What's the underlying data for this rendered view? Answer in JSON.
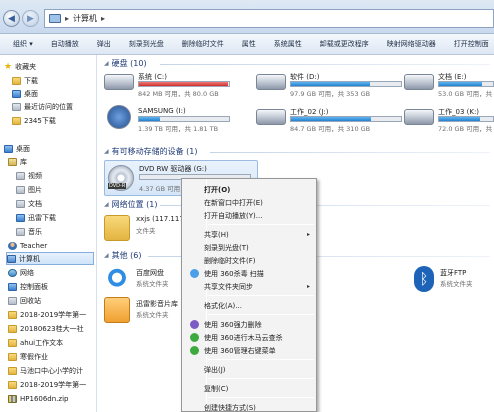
{
  "address": {
    "path_root": "▸",
    "path": "计算机",
    "path_arrow": "▸"
  },
  "toolbar": [
    "组织 ▾",
    "自动播放",
    "弹出",
    "刻录到光盘",
    "删除临时文件",
    "属性",
    "系统属性",
    "卸载或更改程序",
    "映射网络驱动器",
    "打开控制面"
  ],
  "nav": {
    "favorites": {
      "label": "收藏夹",
      "items": [
        "下载",
        "桌面",
        "最近访问的位置",
        "2345下载"
      ]
    },
    "desktop": "桌面",
    "libraries": {
      "label": "库",
      "items": [
        "视频",
        "图片",
        "文档",
        "迅雷下载",
        "音乐"
      ]
    },
    "teacher": "Teacher",
    "computer": "计算机",
    "network": "网络",
    "control_panel": "控制面板",
    "recycle": "回收站",
    "folders": [
      "2018-2019学年第一",
      "20180623桂大一社",
      "ahui工作文本",
      "寒假作业",
      "马池口中心小学的计",
      "2018-2019学年第一",
      "HP1606dn.zip"
    ]
  },
  "groups": {
    "hdd": "硬盘 (10)",
    "removable": "有可移动存储的设备 (1)",
    "netloc": "网络位置 (1)",
    "other": "其他 (6)"
  },
  "drives": [
    {
      "name": "系统 (C:)",
      "sub": "842 MB 可用，共 80.0 GB",
      "used": 0.99,
      "warn": true
    },
    {
      "name": "软件 (D:)",
      "sub": "97.9 GB 可用，共 353 GB",
      "used": 0.72,
      "warn": false
    },
    {
      "name": "文档 (E:)",
      "sub": "53.0 GB 可用，共",
      "used": 0.8,
      "warn": false
    },
    {
      "name": "SAMSUNG (I:)",
      "sub": "1.39 TB 可用，共 1.81 TB",
      "used": 0.23,
      "warn": false
    },
    {
      "name": "工作_02 (J:)",
      "sub": "84.7 GB 可用，共 310 GB",
      "used": 0.73,
      "warn": false
    },
    {
      "name": "工作_03 (K:)",
      "sub": "72.0 GB 可用，共",
      "used": 0.75,
      "warn": false
    }
  ],
  "dvd": {
    "name": "DVD RW 驱动器 (G:)",
    "sub": "4.37 GB 可用，共",
    "tag": "DVD-R",
    "used": 0.05
  },
  "netloc": {
    "name": "xxjs (117.117",
    "sub": "文件夹"
  },
  "other": [
    {
      "name": "百度网盘",
      "sub": "系统文件夹"
    },
    {
      "name": "迅雷影音片库",
      "sub": "系统文件夹"
    },
    {
      "name": "蓝牙FTP",
      "sub": "系统文件夹"
    }
  ],
  "menu": [
    {
      "label": "打开(O)",
      "bold": true
    },
    {
      "label": "在新窗口中打开(E)"
    },
    {
      "label": "打开自动播放(Y)..."
    },
    {
      "sep": true
    },
    {
      "label": "共享(H)",
      "arrow": "▸"
    },
    {
      "label": "刻录到光盘(T)"
    },
    {
      "label": "删除临时文件(F)"
    },
    {
      "label": "使用 360杀毒 扫描",
      "icon": "#4aa0e6"
    },
    {
      "label": "共享文件夹同步",
      "arrow": "▸"
    },
    {
      "sep": true
    },
    {
      "label": "格式化(A)..."
    },
    {
      "sep": true
    },
    {
      "label": "使用 360强力删除",
      "icon": "#7c5cc4"
    },
    {
      "label": "使用 360进行木马云查杀",
      "icon": "#3caa3c"
    },
    {
      "label": "使用 360管理右键菜单",
      "icon": "#3caa3c"
    },
    {
      "sep": true
    },
    {
      "label": "弹出(J)"
    },
    {
      "sep": true
    },
    {
      "label": "复制(C)"
    },
    {
      "sep": true
    },
    {
      "label": "创建快捷方式(S)"
    }
  ],
  "colors": {
    "accent": "#2382d1",
    "warn": "#d12d2d",
    "group_text": "#1e3a78"
  }
}
